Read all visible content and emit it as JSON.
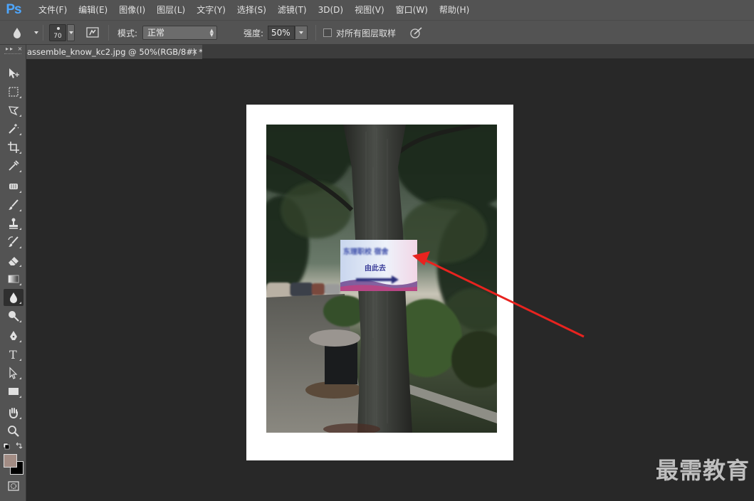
{
  "app": {
    "logo": "Ps"
  },
  "menu": [
    "文件(F)",
    "编辑(E)",
    "图像(I)",
    "图层(L)",
    "文字(Y)",
    "选择(S)",
    "滤镜(T)",
    "3D(D)",
    "视图(V)",
    "窗口(W)",
    "帮助(H)"
  ],
  "options": {
    "brush_size": "70",
    "mode_label": "模式:",
    "mode_value": "正常",
    "strength_label": "强度:",
    "strength_value": "50%",
    "sample_all_label": "对所有图层取样",
    "sample_all_checked": false
  },
  "tab": {
    "title": "assemble_know_kc2.jpg @ 50%(RGB/8#) *",
    "close": "×"
  },
  "toolbox": {
    "header": "▸▸ ×",
    "active_tool": "blur-tool"
  },
  "photo": {
    "sign_line1": "东理职校 宿舍",
    "sign_line2": "由此去"
  },
  "colors": {
    "accent": "#4ea7ff",
    "arrow": "#e8231f",
    "foreground": "#a28c84",
    "background": "#000000"
  },
  "watermark": "最需教育"
}
